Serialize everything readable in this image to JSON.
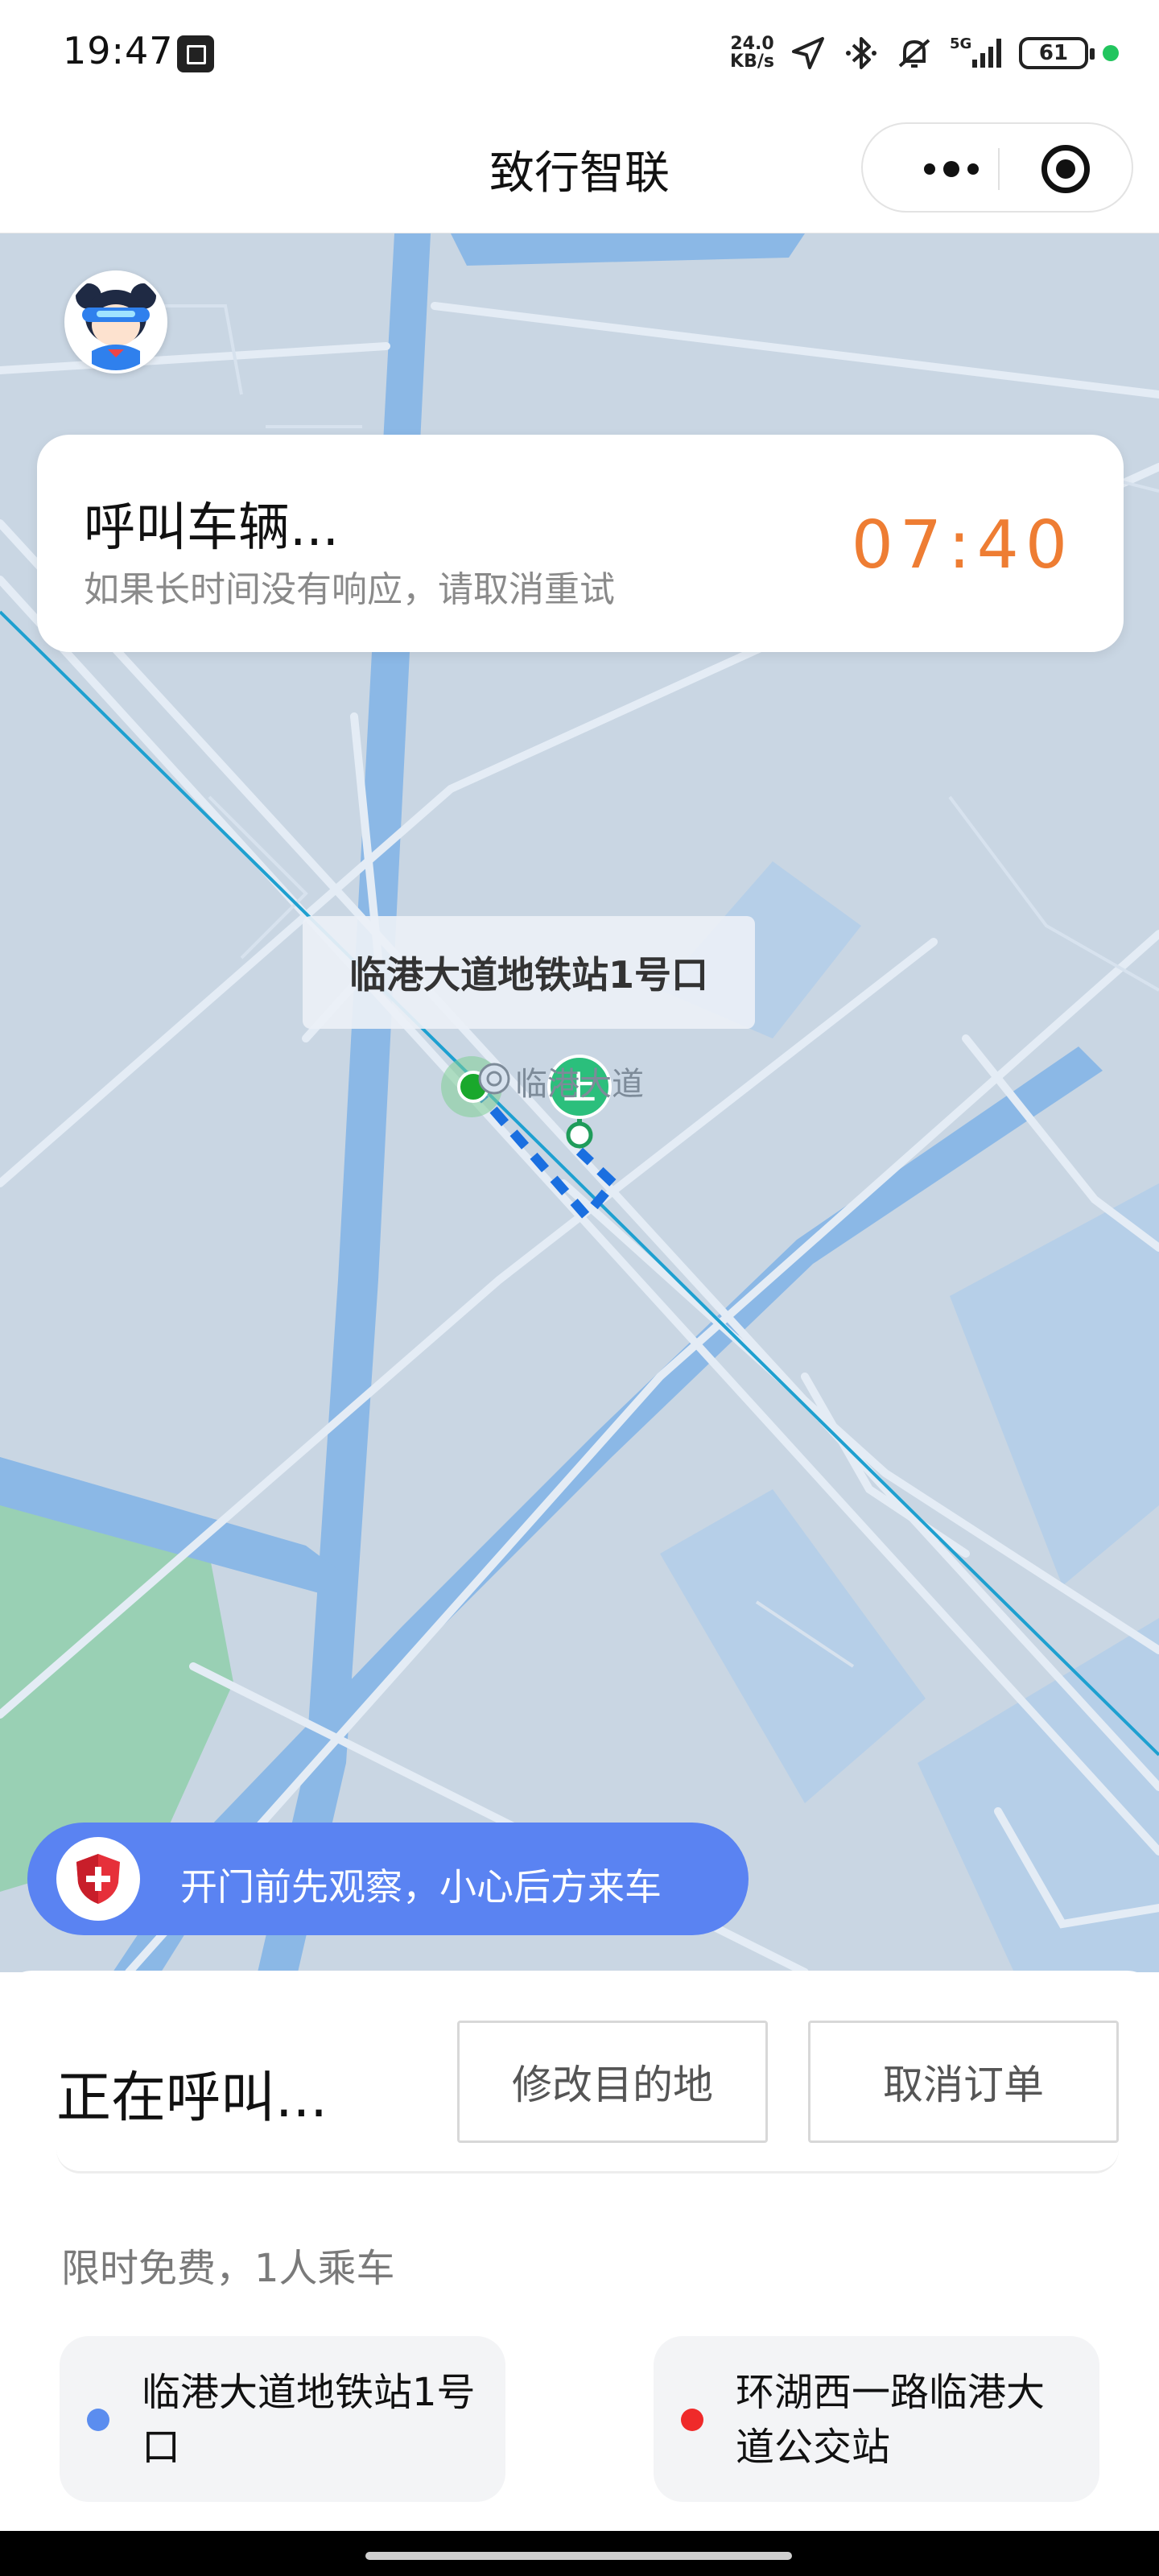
{
  "status_bar": {
    "time": "19:47",
    "speed_value": "24.0",
    "speed_unit": "KB/s",
    "network": "5G",
    "battery": "61",
    "icons": [
      "notification-icon",
      "location-icon",
      "bluetooth-icon",
      "mute-icon",
      "signal-icon",
      "battery-icon"
    ]
  },
  "header": {
    "title": "致行智联",
    "more_icon": "more-dots-icon",
    "close_icon": "target-close-icon"
  },
  "call_card": {
    "title": "呼叫车辆...",
    "subtitle": "如果长时间没有响应，请取消重试",
    "timer": "07:40"
  },
  "map": {
    "pickup_label": "临港大道地铁站1号口",
    "road_name": "临港大道",
    "pickup_marker_text": "上"
  },
  "safety_banner": {
    "text": "开门前先观察，小心后方来车",
    "icon": "shield-plus-icon"
  },
  "bottom_panel": {
    "status": "正在呼叫...",
    "modify_button": "修改目的地",
    "cancel_button": "取消订单",
    "fare_note": "限时免费，1人乘车",
    "start_stop": "临港大道地铁站1号口",
    "end_stop": "环湖西一路临港大道公交站"
  },
  "colors": {
    "timer": "#ee7d33",
    "banner": "#5a83f2",
    "start_dot": "#5b8def",
    "end_dot": "#ef2a2a",
    "route": "#1a6fe0",
    "metro_line": "#1ea0d0"
  }
}
